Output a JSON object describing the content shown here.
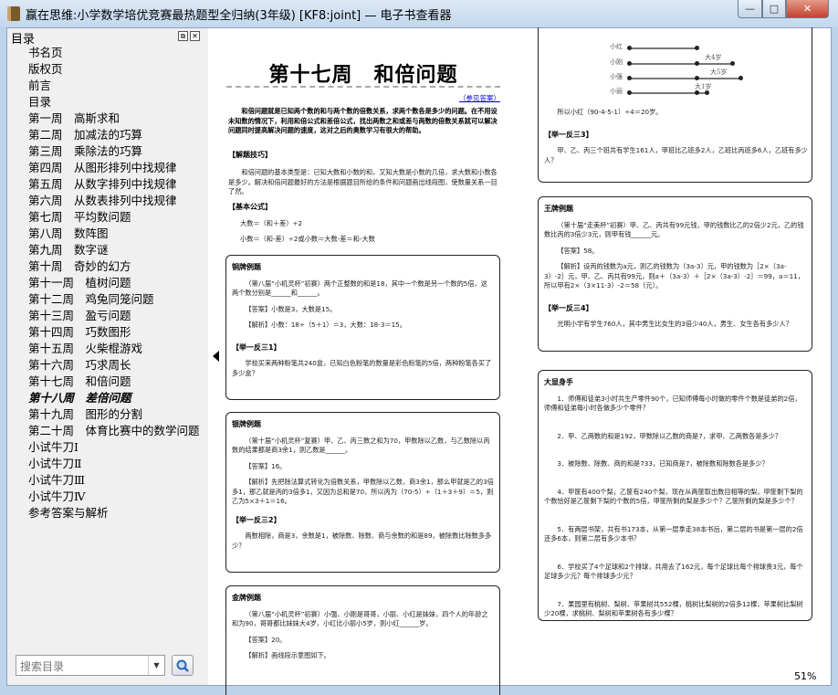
{
  "window": {
    "title": "赢在思维:小学数学培优竞赛最热题型全归纳(3年级) [KF8:joint] — 电子书查看器",
    "minimize": "—",
    "maximize": "□",
    "close": "✕"
  },
  "sidebar": {
    "title": "目录",
    "search_placeholder": "搜索目录",
    "items": [
      "书名页",
      "版权页",
      "前言",
      "目录",
      "第一周　高斯求和",
      "第二周　加减法的巧算",
      "第三周　乘除法的巧算",
      "第四周　从图形排列中找规律",
      "第五周　从数字排列中找规律",
      "第六周　从数表排列中找规律",
      "第七周　平均数问题",
      "第八周　数阵图",
      "第九周　数字谜",
      "第十周　奇妙的幻方",
      "第十一周　植树问题",
      "第十二周　鸡兔同笼问题",
      "第十三周　盈亏问题",
      "第十四周　巧数图形",
      "第十五周　火柴棍游戏",
      "第十六周　巧求周长",
      "第十七周　和倍问题",
      "第十八周　差倍问题",
      "第十九周　图形的分割",
      "第二十周　体育比赛中的数学问题",
      "小试牛刀Ⅰ",
      "小试牛刀Ⅱ",
      "小试牛刀Ⅲ",
      "小试牛刀Ⅳ",
      "参考答案与解析"
    ],
    "active_index": 21
  },
  "status": {
    "zoom": "51%"
  },
  "left_page": {
    "title": "第十七周　和倍问题",
    "answer_link": "（参见答案）",
    "intro": "和倍问题就是已知两个数的和与两个数的倍数关系，求两个数各是多少的问题。在不用设未知数的情况下，利用和倍公式和差倍公式，找出两数之和或差与两数的倍数关系就可以解决问题同时提高解决问题的速度，这对之后的奥数学习有很大的帮助。",
    "tips_heading": "【解题技巧】",
    "tips": "和倍问题的基本类型是：已知大数和小数的和，又知大数是小数的几倍，求大数和小数各是多少。解决和倍问题最好的方法是根据题目所给的条件和问题画出线段图，使数量关系一目了然。",
    "formula_heading": "【基本公式】",
    "formula1": "大数＝（和＋差）÷2",
    "formula2": "小数＝（和-差）÷2或小数＝大数-差＝和-大数",
    "bronze": {
      "heading": "铜牌例题",
      "question": "（第八届“小机灵杯”初赛）两个正整数的和是18，其中一个数是另一个数的5倍，这两个数分别是______和______。",
      "answer": "【答案】小数是3，大数是15。",
      "analysis": "【解析】小数：18÷（5＋1）＝3，大数：18-3＝15。",
      "practice_heading": "【举一反三1】",
      "practice": "学校买来两种粉笔共240盒，已知白色粉笔的数量是彩色粉笔的5倍，两种粉笔各买了多少盒？"
    },
    "silver": {
      "heading": "银牌例题",
      "question": "（第十届“小机灵杯”复赛）甲、乙、丙三数之和为70，甲数除以乙数，与乙数除以丙数的结果都是商3余1，则乙数是______。",
      "answer": "【答案】16。",
      "analysis": "【解析】先把除法算式转化为倍数关系，甲数除以乙数，商3余1，那么甲就是乙的3倍多1，那乙就是丙的3倍多1，又因为总和是70，所以丙为（70-5）÷（1＋3＋9）＝5，则乙为5×3＋1＝16。",
      "practice_heading": "【举一反三2】",
      "practice": "两数相除，商是3，余数是1，被除数、除数、商与余数的和是89，被除数比除数多多少？"
    },
    "gold": {
      "heading": "金牌例题",
      "question": "（第八届“小机灵杯”初赛）小强、小刚是哥哥，小丽、小红是妹妹，四个人的年龄之和为90，哥哥都比妹妹大4岁，小红比小丽小5岁，则小红______岁。",
      "answer": "【答案】20。",
      "analysis": "【解析】画线段示意图如下。"
    }
  },
  "right_page": {
    "diagram": {
      "labels": [
        "小红",
        "小刚",
        "小强",
        "小丽"
      ],
      "notes": [
        "大4岁",
        "大5岁",
        "大1岁"
      ]
    },
    "conclusion": "所以小红（90-4-5-1）÷4＝20岁。",
    "practice3_heading": "【举一反三3】",
    "practice3": "甲、乙、丙三个班共有学生161人，甲班比乙班多2人，乙班比丙班多6人，乙班有多少人？",
    "king": {
      "heading": "王牌例题",
      "question": "（第十届“走美杯”初赛）甲、乙、丙共有99元钱，甲的钱数比乙的2倍少2元，乙的钱数比丙的3倍少3元，则甲有钱______元。",
      "answer": "【答案】58。",
      "analysis": "【解析】设丙的钱数为a元，则乙的钱数为（3a-3）元，甲的钱数为［2×（3a-3）-2］元，甲、乙、丙共有99元，则a＋（3a-3）＋［2×（3a-3）-2］＝99，a＝11，所以甲有2×（3×11-3）-2＝58（元）。",
      "practice_heading": "【举一反三4】",
      "practice": "光明小学有学生760人，其中男生比女生的3倍少40人，男生、女生各有多少人？"
    },
    "show": {
      "heading": "大显身手",
      "items": [
        "1．师傅和徒弟3小时共生产零件90个，已知师傅每小时做的零件个数是徒弟的2倍，师傅和徒弟每小时各做多少个零件？",
        "2．甲、乙两数的和是192，甲数除以乙数的商是7，求甲、乙两数各是多少？",
        "3．被除数、除数、商的和是733，已知商是7，被除数和除数各是多少？",
        "4．甲筐有400个梨，乙筐有240个梨，现在从两筐取出数目相等的梨，甲筐剩下梨的个数恰好是乙筐剩下梨的个数的5倍，甲筐所剩的梨是多少个？乙筐所剩的梨是多少个？",
        "5．有两层书架，共有书173本，从第一层拿走38本书后，第二层的书是第一层的2倍还多6本，则第二层有多少本书？",
        "6．学校买了4个足球和2个排球，共用去了162元，每个足球比每个排球贵3元，每个足球多少元？每个排球多少元？",
        "7．果园里有桃树、梨树、苹果树共552棵，桃树比梨树的2倍多12棵，苹果树比梨树少20棵，求桃树、梨树和苹果树各有多少棵？"
      ]
    }
  }
}
